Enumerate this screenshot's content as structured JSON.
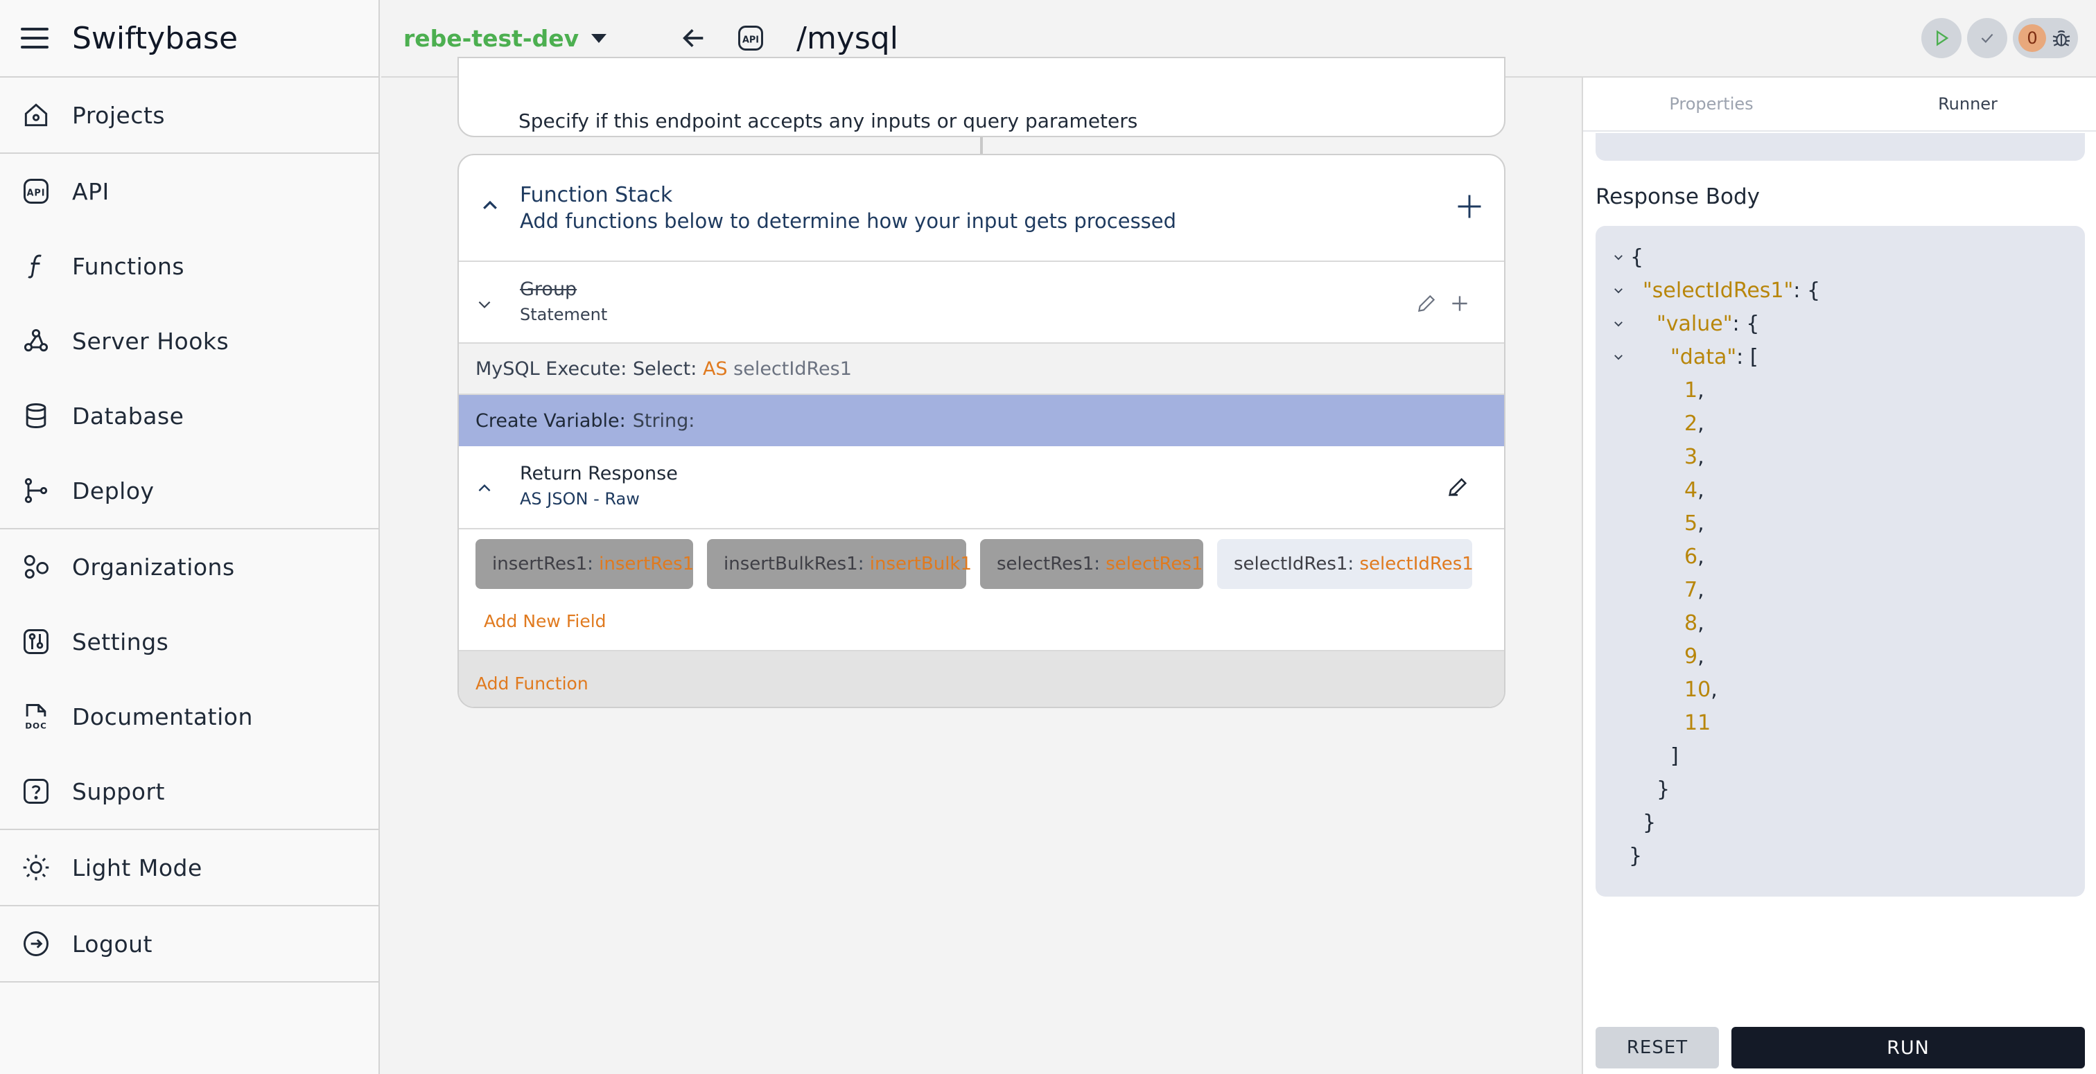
{
  "app": {
    "name": "Swiftybase"
  },
  "sidebar": {
    "groups": [
      [
        {
          "label": "Projects",
          "icon": "home-icon"
        }
      ],
      [
        {
          "label": "API",
          "icon": "api-icon"
        },
        {
          "label": "Functions",
          "icon": "function-icon"
        },
        {
          "label": "Server Hooks",
          "icon": "webhook-icon"
        },
        {
          "label": "Database",
          "icon": "database-icon"
        },
        {
          "label": "Deploy",
          "icon": "git-branch-icon"
        }
      ],
      [
        {
          "label": "Organizations",
          "icon": "organizations-icon"
        },
        {
          "label": "Settings",
          "icon": "settings-icon"
        },
        {
          "label": "Documentation",
          "icon": "doc-icon"
        },
        {
          "label": "Support",
          "icon": "help-icon"
        }
      ],
      [
        {
          "label": "Light Mode",
          "icon": "sun-icon"
        }
      ],
      [
        {
          "label": "Logout",
          "icon": "logout-icon"
        }
      ]
    ]
  },
  "topbar": {
    "environment": "rebe-test-dev",
    "path": "/mysql",
    "api_badge": "API",
    "error_count": "0"
  },
  "canvas": {
    "inputs_desc": "Specify if this endpoint accepts any inputs or query parameters",
    "stack": {
      "title": "Function Stack",
      "subtitle": "Add functions below to determine how your input gets processed",
      "group": {
        "title": "Group",
        "subtitle": "Statement"
      },
      "mysql": {
        "prefix": "MySQL Execute: Select:",
        "as": "AS",
        "var": "selectIdRes1"
      },
      "create_var": {
        "prefix": "Create Variable:",
        "type": "String:"
      },
      "response": {
        "title": "Return Response",
        "subtitle": "AS JSON - Raw",
        "fields": [
          {
            "key": "insertRes1",
            "value": "insertRes1"
          },
          {
            "key": "insertBulkRes1",
            "value": "insertBulk1"
          },
          {
            "key": "selectRes1",
            "value": "selectRes1"
          },
          {
            "key": "selectIdRes1",
            "value": "selectIdRes1"
          }
        ],
        "add_field": "Add New Field"
      },
      "add_function": "Add Function"
    }
  },
  "runner": {
    "tabs": [
      "Properties",
      "Runner"
    ],
    "active_tab": "Runner",
    "response_label": "Response Body",
    "json": {
      "open_brace": "{",
      "key1": "\"selectIdRes1\"",
      "key2": "\"value\"",
      "key3": "\"data\"",
      "numbers": [
        "1",
        "2",
        "3",
        "4",
        "5",
        "6",
        "7",
        "8",
        "9",
        "10",
        "11"
      ],
      "close_bracket": "]",
      "close_brace": "}"
    },
    "reset_label": "RESET",
    "run_label": "RUN"
  },
  "colors": {
    "accent_orange": "#e07a1f",
    "env_green": "#4caf50",
    "highlight_row": "#a3b1df",
    "run_dark": "#141a27"
  }
}
